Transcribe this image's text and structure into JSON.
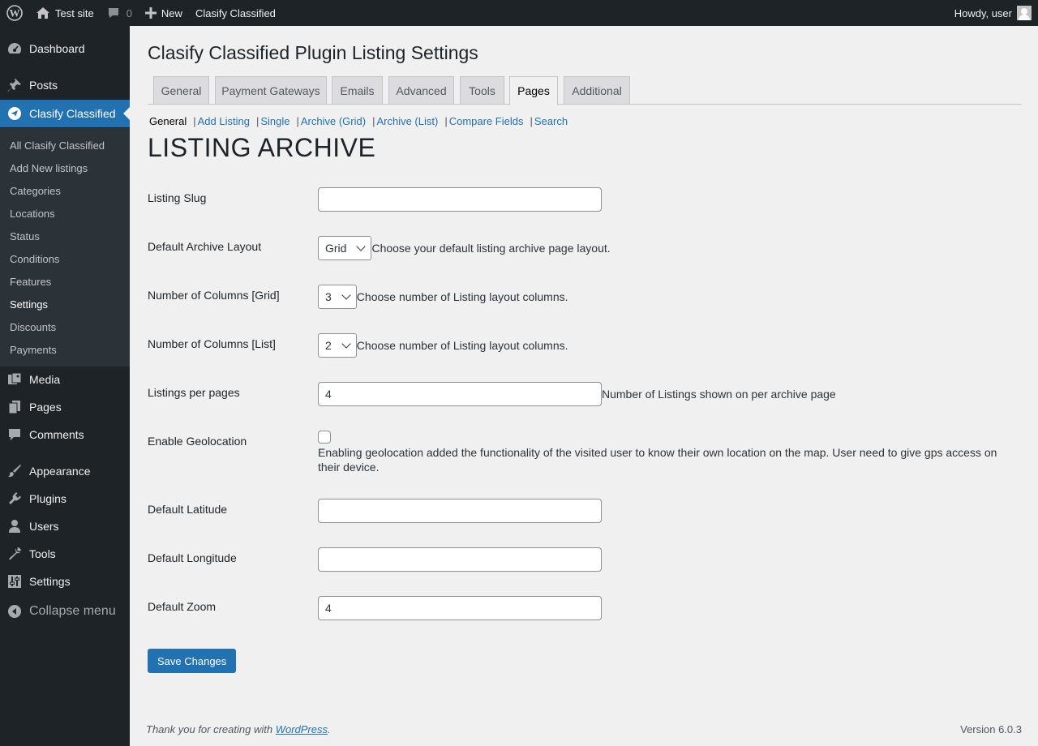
{
  "admin_bar": {
    "site_name": "Test site",
    "comments_count": "0",
    "new_label": "New",
    "plugin_link": "Clasify Classified",
    "greeting": "Howdy, user"
  },
  "sidebar": {
    "dashboard": "Dashboard",
    "posts": "Posts",
    "clasify": "Clasify Classified",
    "submenu": [
      "All Clasify Classified",
      "Add New listings",
      "Categories",
      "Locations",
      "Status",
      "Conditions",
      "Features",
      "Settings",
      "Discounts",
      "Payments"
    ],
    "media": "Media",
    "pages": "Pages",
    "comments": "Comments",
    "appearance": "Appearance",
    "plugins": "Plugins",
    "users": "Users",
    "tools": "Tools",
    "settings": "Settings",
    "collapse": "Collapse menu"
  },
  "page": {
    "title": "Clasify Classified Plugin Listing Settings",
    "tabs": [
      "General",
      "Payment Gateways",
      "Emails",
      "Advanced",
      "Tools",
      "Pages",
      "Additional"
    ],
    "active_tab": "Pages",
    "subsub": [
      "General",
      "Add Listing",
      "Single",
      "Archive (Grid)",
      "Archive (List)",
      "Compare Fields",
      "Search"
    ],
    "section_title": "LISTING ARCHIVE"
  },
  "form": {
    "listing_slug": {
      "label": "Listing Slug",
      "value": ""
    },
    "default_layout": {
      "label": "Default Archive Layout",
      "value": "Grid",
      "desc": "Choose your default listing archive page layout."
    },
    "columns_grid": {
      "label": "Number of Columns [Grid]",
      "value": "3",
      "desc": "Choose number of Listing layout columns."
    },
    "columns_list": {
      "label": "Number of Columns [List]",
      "value": "2",
      "desc": "Choose number of Listing layout columns."
    },
    "per_page": {
      "label": "Listings per pages",
      "value": "4",
      "desc": "Number of Listings shown on per archive page"
    },
    "geolocation": {
      "label": "Enable Geolocation",
      "checked": false,
      "desc": "Enabling geolocation added the functionality of the visited user to know their own location on the map. User need to give gps access on their device."
    },
    "latitude": {
      "label": "Default Latitude",
      "value": ""
    },
    "longitude": {
      "label": "Default Longitude",
      "value": ""
    },
    "zoom": {
      "label": "Default Zoom",
      "value": "4"
    },
    "save_label": "Save Changes"
  },
  "footer": {
    "thanks_prefix": "Thank you for creating with ",
    "wordpress_link": "WordPress",
    "thanks_suffix": ".",
    "version": "Version 6.0.3"
  },
  "colors": {
    "admin_dark": "#1d2327",
    "accent": "#2271b1",
    "submenu_bg": "#2c3338",
    "page_bg": "#f0f0f1"
  }
}
